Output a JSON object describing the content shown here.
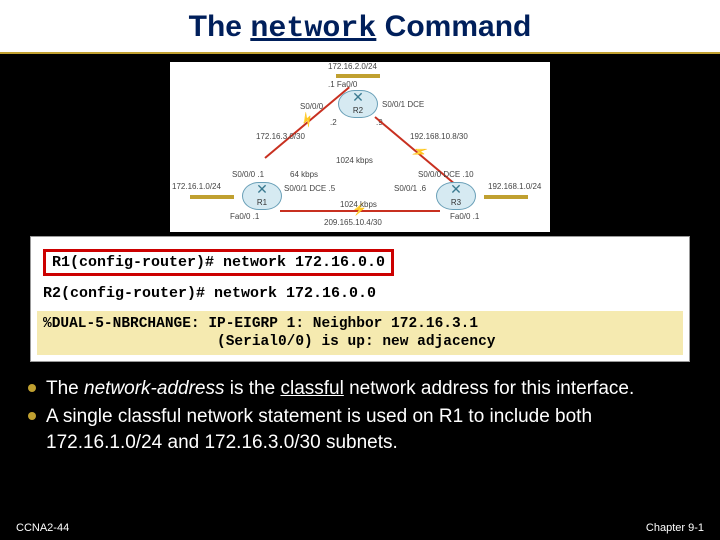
{
  "title": {
    "pre": "The ",
    "code": "network",
    "post": " Command"
  },
  "topology": {
    "routers": {
      "r1": "R1",
      "r2": "R2",
      "r3": "R3"
    },
    "labels": {
      "top_net": "172.16.2.0/24",
      "top_if": ".1  Fa0/0",
      "r2_s000": "S0/0/0",
      "r2_s001": "S0/0/1  DCE",
      "r2_left_ip": ".2",
      "r2_right_ip": ".9",
      "left_serial_net": "172.16.3.0/30",
      "right_serial_net": "192.168.10.8/30",
      "mid_bw_top": "1024 kbps",
      "mid_bw_l": "64 kbps",
      "mid_bw_r": "1024 kbps",
      "r1_s000": "S0/0/0  .1",
      "r1_s001": "S0/0/1  DCE  .5",
      "r3_s000": "S0/0/0  DCE  .10",
      "r3_s001": "S0/0/1  .6",
      "left_lan_net": "172.16.1.0/24",
      "right_lan_net": "192.168.1.0/24",
      "r1_fa": "Fa0/0  .1",
      "r3_fa": "Fa0/0  .1",
      "bottom_net": "209.165.10.4/30"
    }
  },
  "commands": {
    "r1_prompt": "R1(config-router)# ",
    "r1_cmd": "network 172.16.0.0",
    "r2_prompt": "R2(config-router)# ",
    "r2_cmd": "network 172.16.0.0",
    "log": "%DUAL-5-NBRCHANGE: IP-EIGRP 1: Neighbor 172.16.3.1\n                    (Serial0/0) is up: new adjacency"
  },
  "bullets": [
    "The <em>network-address</em> is the <u>classful</u> network address for this interface.",
    "A single classful network statement is used on R1 to include both 172.16.1.0/24 and 172.16.3.0/30 subnets."
  ],
  "footer": {
    "left": "CCNA2-44",
    "right": "Chapter 9-1"
  }
}
